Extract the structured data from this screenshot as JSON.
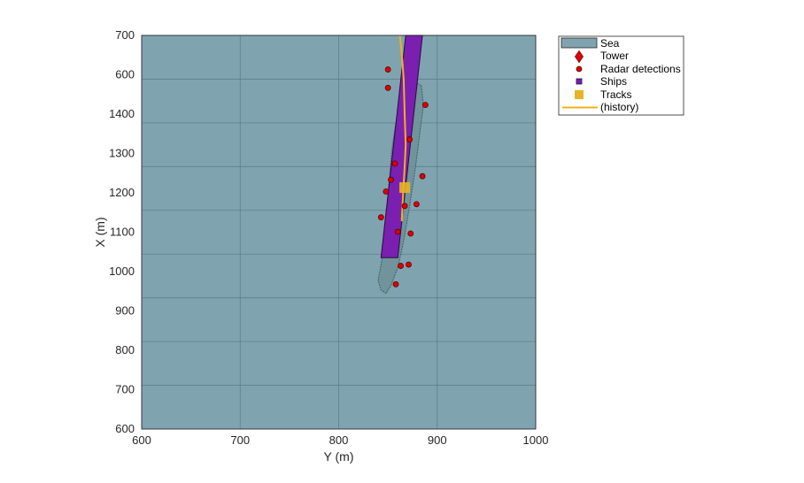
{
  "chart_data": {
    "type": "scatter",
    "xlabel": "Y (m)",
    "ylabel": "X (m)",
    "xlim": [
      600,
      1000
    ],
    "ylim": [
      600,
      1500
    ],
    "x_ticks": [
      600,
      700,
      800,
      900,
      1000
    ],
    "y_ticks": [
      600,
      700,
      800,
      900,
      1000,
      1100,
      1200,
      1300,
      1400,
      1500
    ],
    "y_tick_labels": [
      "600",
      "700",
      "800",
      "900",
      "1000",
      "1100",
      "1200",
      "1300",
      "1400",
      "600",
      "700"
    ],
    "grid": true,
    "legend_position": "outside-top-right",
    "legend": [
      {
        "label": "Sea",
        "marker": "patch",
        "color": "#7fa4b0"
      },
      {
        "label": "Tower",
        "marker": "diamond",
        "color": "#e00000"
      },
      {
        "label": "Radar detections",
        "marker": "circle",
        "color": "#e00000"
      },
      {
        "label": "Ships",
        "marker": "square",
        "color": "#7b1fb0"
      },
      {
        "label": "Tracks",
        "marker": "square",
        "color": "#e8b423"
      },
      {
        "label": "(history)",
        "marker": "line",
        "color": "#f0b020"
      }
    ],
    "sea_color": "#7fa4b0",
    "ship": {
      "corners": [
        [
          868,
          1500
        ],
        [
          885,
          1500
        ],
        [
          860,
          992
        ],
        [
          843,
          992
        ]
      ]
    },
    "radar_detections": [
      [
        850,
        1422
      ],
      [
        850,
        1380
      ],
      [
        888,
        1341
      ],
      [
        872,
        1262
      ],
      [
        857,
        1207
      ],
      [
        885,
        1178
      ],
      [
        853,
        1170
      ],
      [
        848,
        1143
      ],
      [
        879,
        1114
      ],
      [
        867,
        1110
      ],
      [
        843,
        1084
      ],
      [
        873,
        1047
      ],
      [
        860,
        1051
      ],
      [
        863,
        973
      ],
      [
        871,
        976
      ],
      [
        858,
        931
      ]
    ],
    "track": {
      "y": 867,
      "x": 1152
    },
    "track_history": [
      [
        862,
        1500
      ],
      [
        864,
        1460
      ],
      [
        866,
        1400
      ],
      [
        867,
        1320
      ],
      [
        868,
        1250
      ],
      [
        867,
        1200
      ],
      [
        866,
        1160
      ],
      [
        865,
        1120
      ],
      [
        864,
        1075
      ]
    ],
    "detection_extent_outline": [
      [
        884,
        1385
      ],
      [
        886,
        1340
      ],
      [
        882,
        1270
      ],
      [
        878,
        1200
      ],
      [
        872,
        1110
      ],
      [
        866,
        1030
      ],
      [
        860,
        970
      ],
      [
        853,
        928
      ],
      [
        848,
        910
      ],
      [
        843,
        918
      ],
      [
        840,
        940
      ],
      [
        845,
        1000
      ],
      [
        848,
        1080
      ],
      [
        851,
        1160
      ],
      [
        854,
        1240
      ],
      [
        858,
        1300
      ],
      [
        866,
        1350
      ],
      [
        874,
        1378
      ],
      [
        880,
        1390
      ],
      [
        884,
        1385
      ]
    ]
  }
}
